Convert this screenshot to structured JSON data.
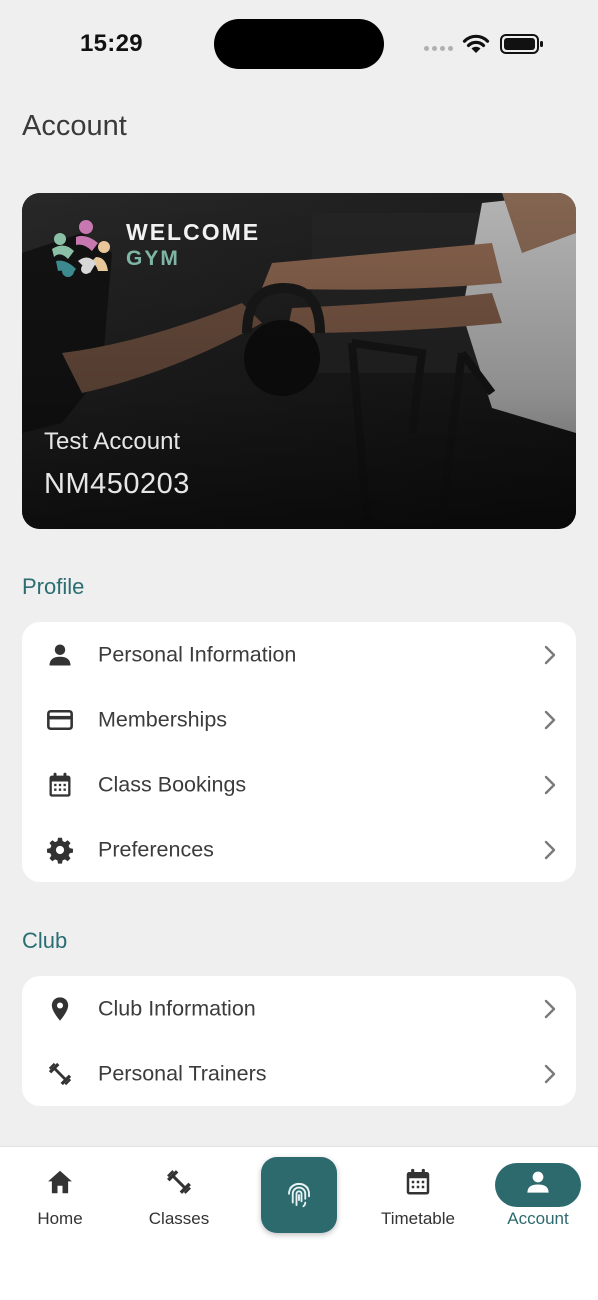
{
  "status_bar": {
    "time": "15:29"
  },
  "page": {
    "title": "Account"
  },
  "member_card": {
    "brand_line1": "WELCOME",
    "brand_line2": "GYM",
    "name": "Test Account",
    "member_id": "NM450203"
  },
  "profile": {
    "title": "Profile",
    "items": [
      {
        "label": "Personal Information",
        "icon": "person-icon"
      },
      {
        "label": "Memberships",
        "icon": "credit-card-icon"
      },
      {
        "label": "Class Bookings",
        "icon": "calendar-icon"
      },
      {
        "label": "Preferences",
        "icon": "gear-icon"
      }
    ]
  },
  "club": {
    "title": "Club",
    "items": [
      {
        "label": "Club Information",
        "icon": "location-pin-icon"
      },
      {
        "label": "Personal Trainers",
        "icon": "dumbbell-icon"
      }
    ]
  },
  "tab_bar": {
    "active": "Account",
    "accent_color": "#2d6a6e",
    "tabs": [
      {
        "label": "Home",
        "icon": "home-icon"
      },
      {
        "label": "Classes",
        "icon": "dumbbell-icon"
      },
      {
        "label": "",
        "icon": "fingerprint-icon"
      },
      {
        "label": "Timetable",
        "icon": "calendar-icon"
      },
      {
        "label": "Account",
        "icon": "person-icon"
      }
    ]
  }
}
